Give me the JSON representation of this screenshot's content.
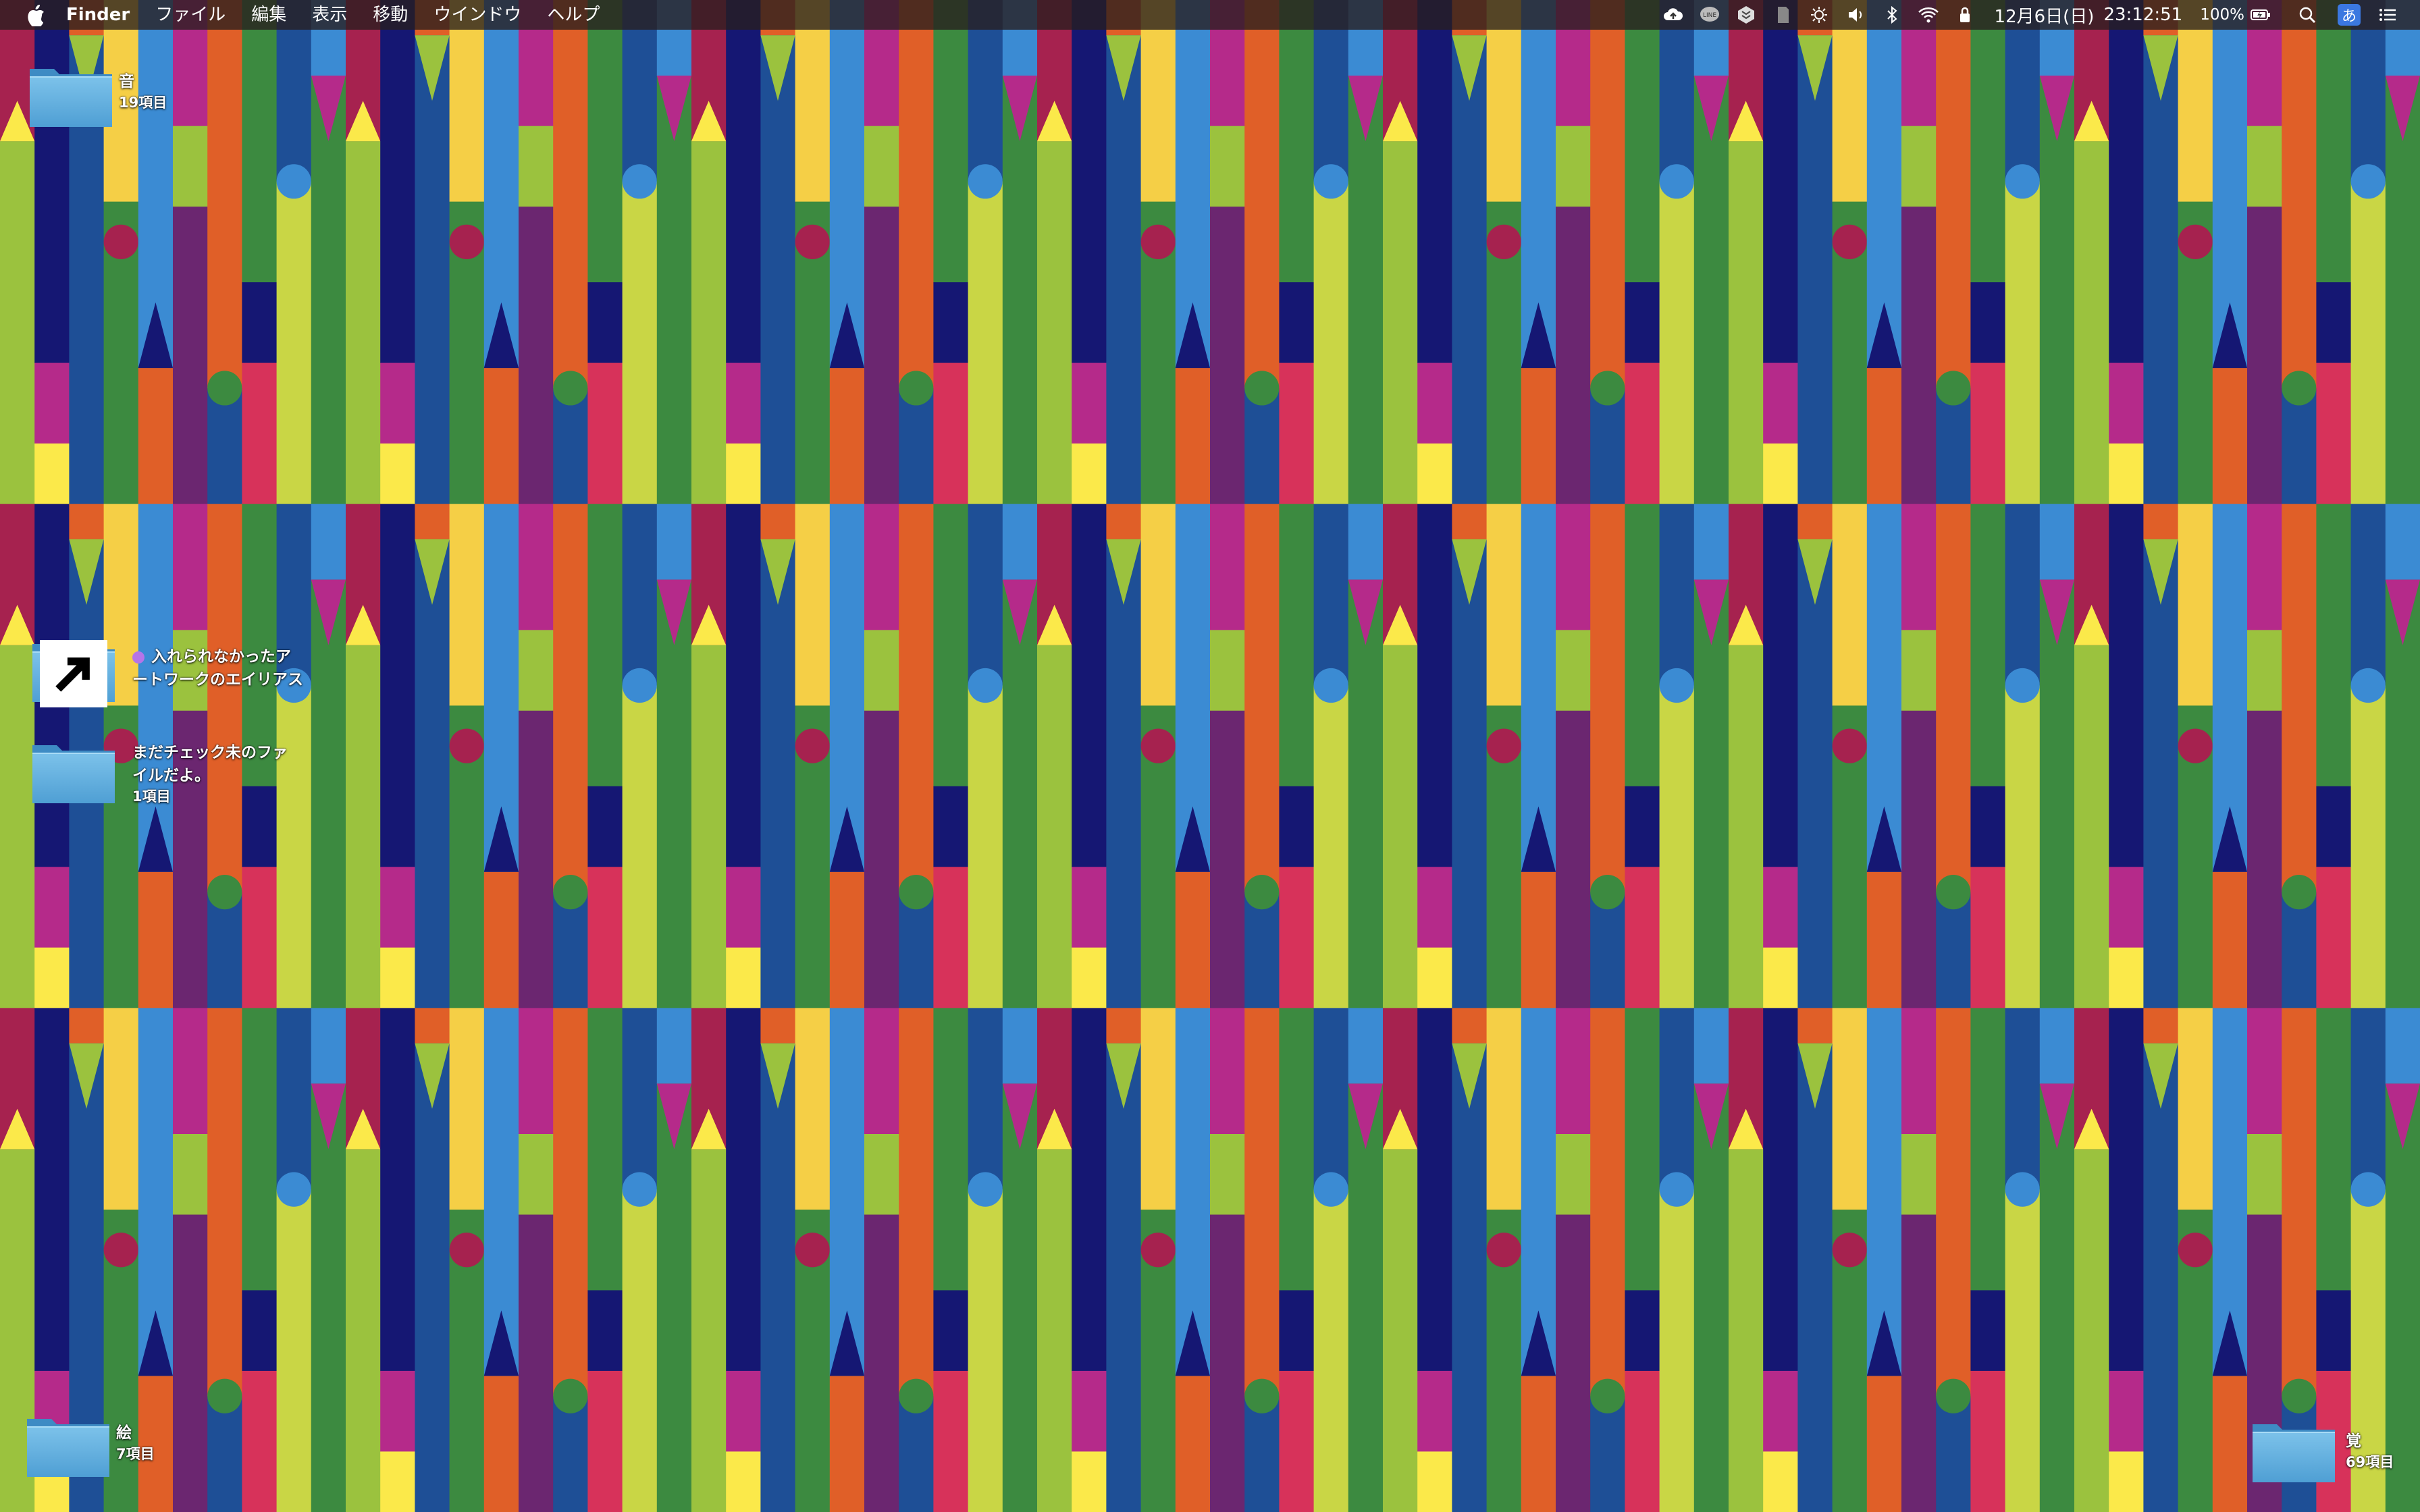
{
  "menubar": {
    "app_name": "Finder",
    "items": [
      "ファイル",
      "編集",
      "表示",
      "移動",
      "ウインドウ",
      "ヘルプ"
    ],
    "status_icons": [
      "cloud-upload-icon",
      "line-app-icon",
      "dropbox-icon",
      "sd-card-icon",
      "brightness-icon",
      "volume-icon",
      "bluetooth-icon",
      "wifi-icon",
      "lock-icon"
    ],
    "date": "12月6日(日)",
    "time": "23:12:51",
    "battery": "100%",
    "ime": "あ"
  },
  "desktop": {
    "icons": [
      {
        "name": "音",
        "count": "19項目"
      },
      {
        "name_line1": "入れられなかったア",
        "name_line2": "ートワークのエイリアス",
        "tag_color": "#b574e8"
      },
      {
        "name_line1": "まだチェック未のファ",
        "name_line2": "イルだよ。",
        "count": "1項目"
      },
      {
        "name": "絵",
        "count": "7項目"
      },
      {
        "name": "覚",
        "count": "69項目"
      }
    ]
  },
  "wallpaper": {
    "palette": [
      "#a6224f",
      "#151773",
      "#1e4f96",
      "#f5cf46",
      "#3b8bd3",
      "#b52a8a",
      "#e05f28",
      "#3c8a40",
      "#c9d645",
      "#9bc23e",
      "#d7325a",
      "#6b2670",
      "#fbe94a"
    ]
  }
}
